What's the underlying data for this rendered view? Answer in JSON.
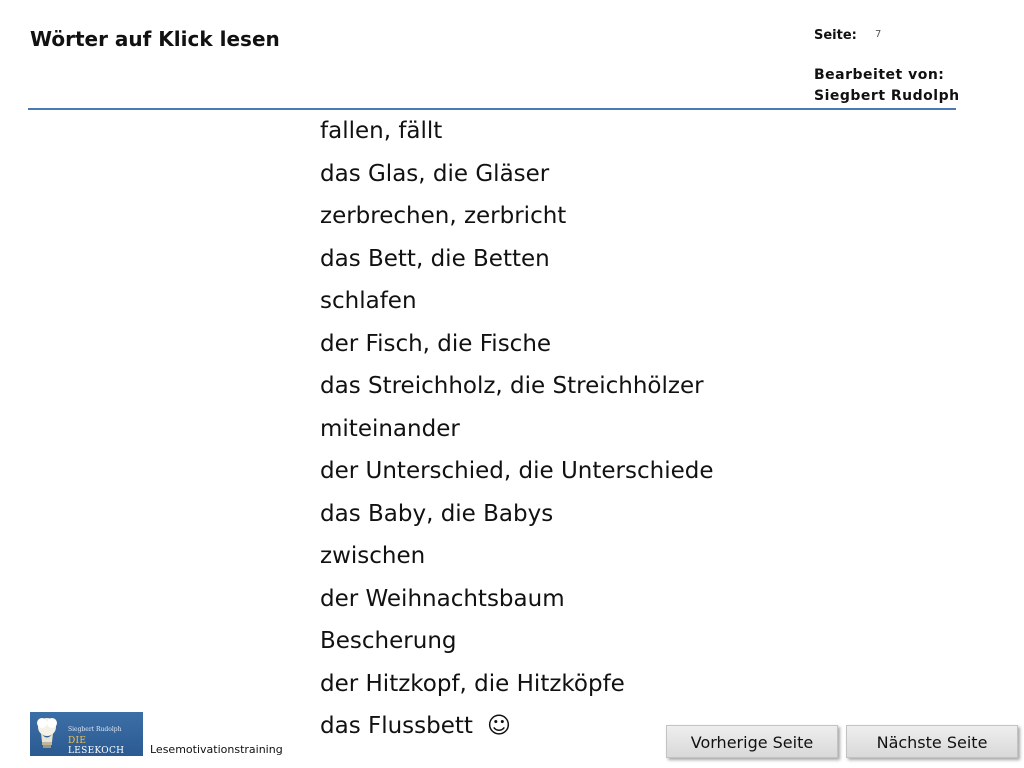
{
  "header": {
    "title": "Wörter auf Klick lesen",
    "page_label": "Seite:",
    "page_number": "7",
    "editor_label": "Bearbeitet von:",
    "editor_name": "Siegbert Rudolph",
    "rule_color": "#4a7ab3"
  },
  "words": [
    "fallen, fällt",
    "das Glas, die Gläser",
    "zerbrechen, zerbricht",
    "das Bett, die Betten",
    "schlafen",
    "der Fisch, die Fische",
    "das Streichholz, die Streichhölzer",
    "miteinander",
    "der Unterschied, die Unterschiede",
    "das Baby, die Babys",
    "zwischen",
    "der Weihnachtsbaum",
    "Bescherung",
    "der Hitzkopf, die Hitzköpfe",
    "das Flussbett"
  ],
  "last_word_icon": "☺",
  "footer": {
    "logo": {
      "author": "Siegbert Rudolph",
      "brand_prefix": "DIE",
      "brand_name": "LESEKOCH",
      "icon": "lightbulb-icon"
    },
    "label": "Lesemotivationstraining",
    "prev_button": "Vorherige Seite",
    "next_button": "Nächste Seite"
  }
}
